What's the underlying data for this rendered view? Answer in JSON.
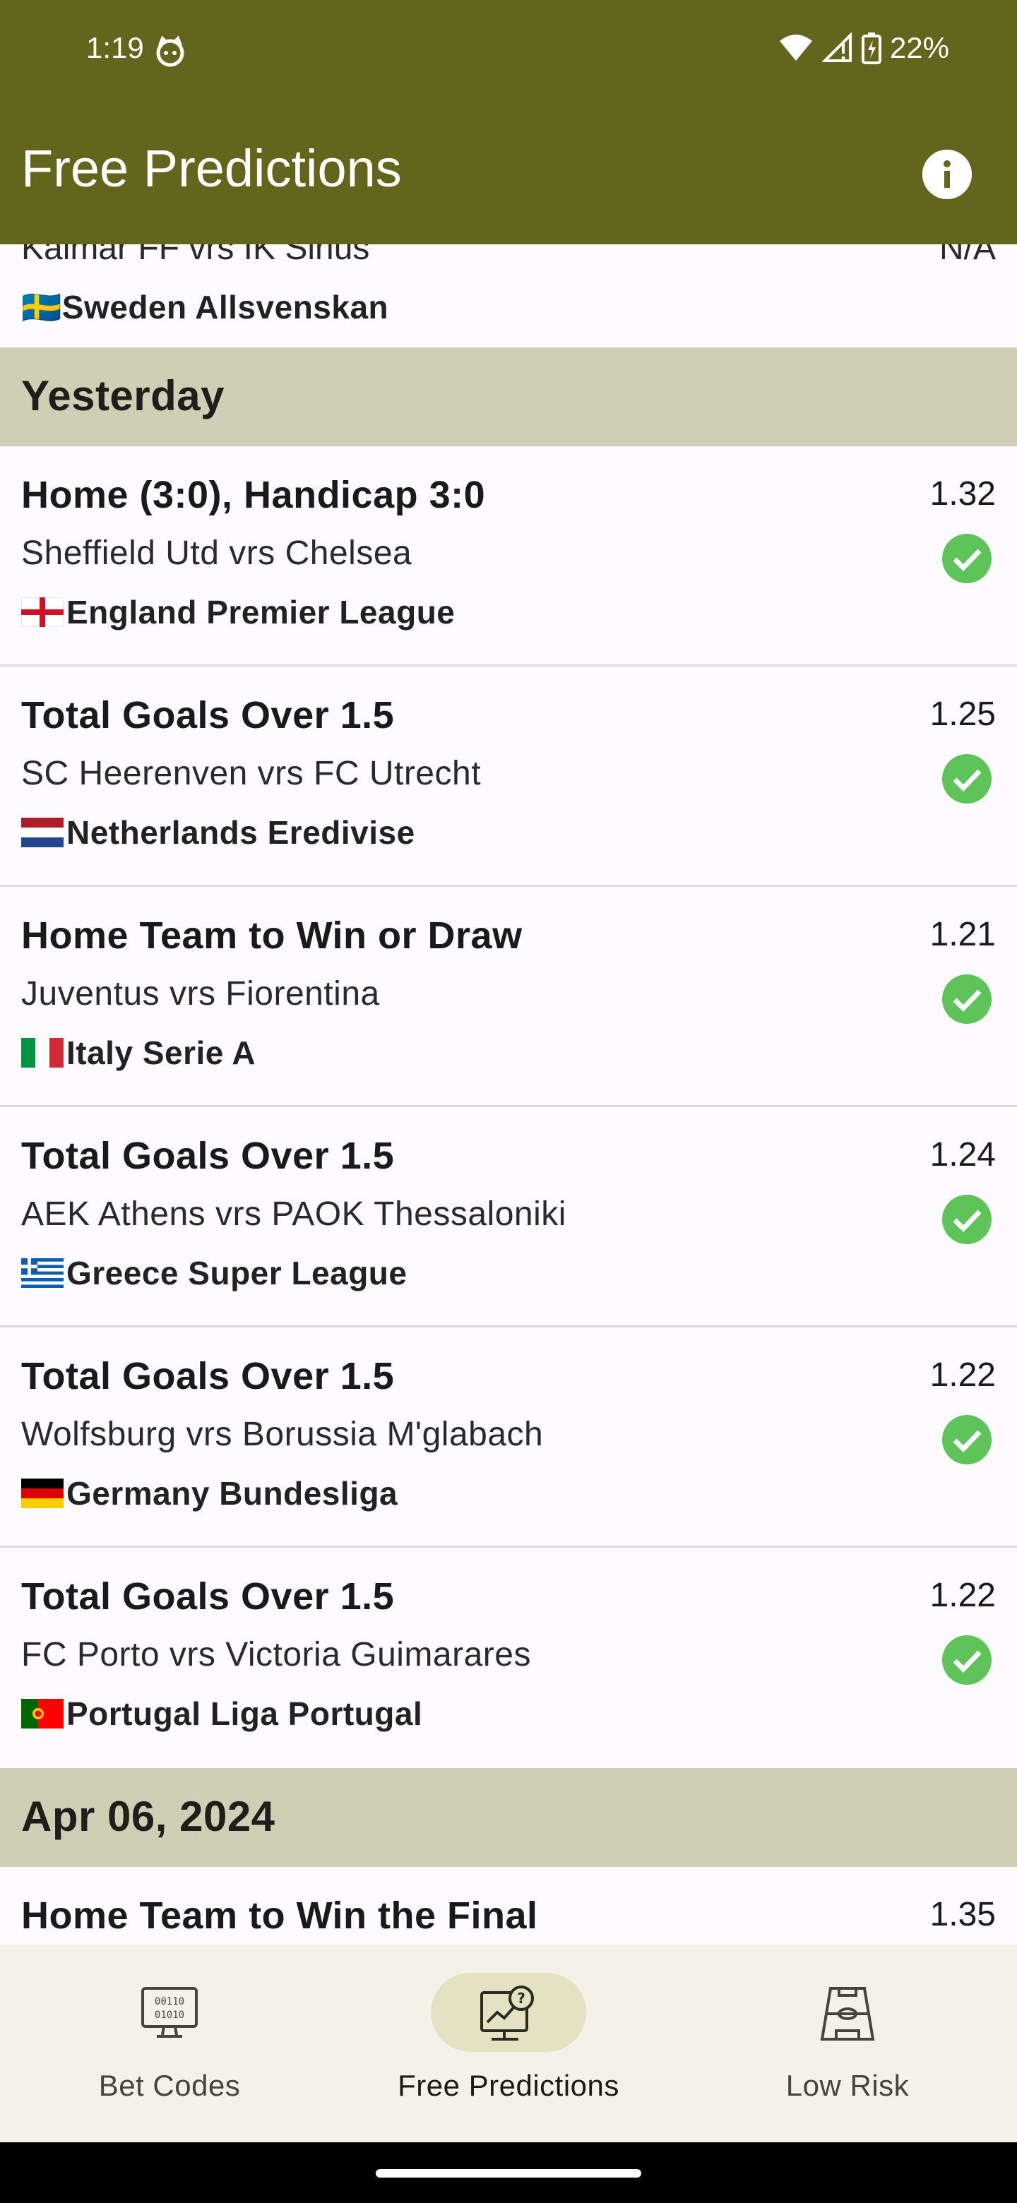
{
  "status_bar": {
    "time": "1:19",
    "battery": "22%"
  },
  "app_bar": {
    "title": "Free Predictions",
    "info_icon": "info-icon"
  },
  "partial_item": {
    "match": "Kalmar FF vrs IK Sirius",
    "odds": "N/A",
    "flag": "🇸🇪",
    "league": "Sweden Allsvenskan"
  },
  "sections": [
    {
      "header": "Yesterday",
      "items": [
        {
          "market": "Home (3:0), Handicap 3:0",
          "match": "Sheffield Utd vrs Chelsea",
          "flag": "🏴",
          "league": "England Premier League",
          "odds": "1.32",
          "status": "won"
        },
        {
          "market": "Total Goals Over 1.5",
          "match": "SC Heerenven vrs FC Utrecht",
          "flag": "🇳🇱",
          "league": "Netherlands Eredivise",
          "odds": "1.25",
          "status": "won"
        },
        {
          "market": "Home Team to Win or Draw",
          "match": "Juventus vrs Fiorentina",
          "flag": "🇮🇹",
          "league": "Italy Serie A",
          "odds": "1.21",
          "status": "won"
        },
        {
          "market": "Total Goals Over 1.5",
          "match": "AEK Athens vrs PAOK Thessaloniki",
          "flag": "🇬🇷",
          "league": "Greece Super League",
          "odds": "1.24",
          "status": "won"
        },
        {
          "market": "Total Goals Over 1.5",
          "match": "Wolfsburg vrs Borussia M'glabach",
          "flag": "🇩🇪",
          "league": "Germany Bundesliga",
          "odds": "1.22",
          "status": "won"
        },
        {
          "market": "Total Goals Over 1.5",
          "match": "FC Porto vrs Victoria Guimarares",
          "flag": "🇵🇹",
          "league": "Portugal Liga Portugal",
          "odds": "1.22",
          "status": "won"
        }
      ]
    },
    {
      "header": "Apr 06, 2024",
      "items": [
        {
          "market": "Home Team to Win the Final",
          "odds": "1.35"
        }
      ]
    }
  ],
  "bottom_nav": [
    {
      "label": "Bet Codes",
      "icon": "binary-monitor-icon",
      "active": false
    },
    {
      "label": "Free Predictions",
      "icon": "prediction-chart-icon",
      "active": true
    },
    {
      "label": "Low Risk",
      "icon": "football-pitch-icon",
      "active": false
    }
  ],
  "colors": {
    "app_bar": "#63651d",
    "section_header": "#d0cfb5",
    "check": "#5ec45a",
    "nav_active_pill": "#e4e2c2"
  }
}
